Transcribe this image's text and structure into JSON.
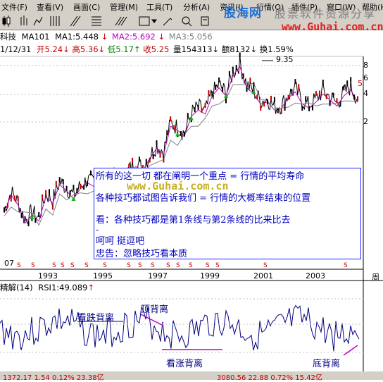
{
  "menu": {
    "items": [
      "文件(F)",
      "查看(V)",
      "画面(C)",
      "管理(M)",
      "工具(T)",
      "分析(A)",
      "资讯(I)",
      "行情(Q)",
      "插件(P)",
      "窗口(W)",
      "帮助(H)"
    ]
  },
  "watermark": {
    "brand_cn": "股海网",
    "brand_sub": "股票软件资源分享",
    "url": "www.Guhai.com.cn"
  },
  "info_bar": {
    "stock_name": "科技",
    "ma_title": "MA101",
    "ma1": "MA1:5.448",
    "ma2": "MA2:5.692",
    "ma3": "MA3:5.056",
    "arrow_down": "↓",
    "date": "1/12/31",
    "open_label": "开",
    "open_value": "5.24",
    "high_label": "高",
    "high_value": "5.36",
    "low_label": "低",
    "low_value": "5.17",
    "close_label": "收",
    "close_value": "5.25",
    "volume_label": "量",
    "volume_value": "154313",
    "amount_label": "额",
    "amount_value": "8132",
    "turnover_label": "换",
    "turnover_value": "1.59%"
  },
  "chart_data": {
    "type": "line",
    "title": "",
    "peak_label": "9.35",
    "y_ticks": [
      "8",
      "6",
      "5",
      "4",
      "2"
    ],
    "x_ticks": [
      "07",
      "1993",
      "1995",
      "1997",
      "1999",
      "2001",
      "2003",
      "周"
    ],
    "price_marker": "5",
    "series": [
      {
        "values": [
          2.1,
          3.0,
          2.5,
          1.6,
          2.0,
          1.7,
          2.9,
          2.6,
          3.5,
          3.2,
          2.8,
          3.3,
          3.6,
          3.4,
          3.2,
          3.6,
          3.8,
          3.5,
          4.1,
          4.4,
          4.2,
          4.8,
          5.3,
          5.0,
          6.4,
          6.2,
          5.9,
          6.9,
          7.2,
          7.0,
          7.9,
          8.3,
          7.9,
          8.9,
          9.35,
          8.3,
          8.0,
          7.5,
          7.6,
          7.2,
          7.3,
          7.8,
          8.1,
          7.5,
          7.3,
          7.6,
          8.0,
          7.7,
          7.4,
          7.9,
          8.2,
          7.6
        ]
      }
    ]
  },
  "note": {
    "lines": [
      "所有的这一切 都在阐明一个重点 = 行情的平均寿命",
      "各种技巧都试图告诉我们 = 行情的大概率结束的位置",
      "看：各种技巧都是第1条线与第2条线的比来比去",
      "-",
      "呵呵 挺逗吧",
      "忠告：忽略技巧看本质"
    ]
  },
  "rsi": {
    "title": "精解(14)",
    "value": "RSI1:49.089",
    "arrow": "↑",
    "labels": {
      "bear_div": "看跌背离",
      "top_div": "顶背离",
      "bull_div": "看涨背离",
      "bottom_div": "底背离"
    }
  },
  "status": {
    "left": "1372.17  1.54  0.12%  23.38亿",
    "right": "3080.56  22.88  0.72%  15.42亿"
  }
}
